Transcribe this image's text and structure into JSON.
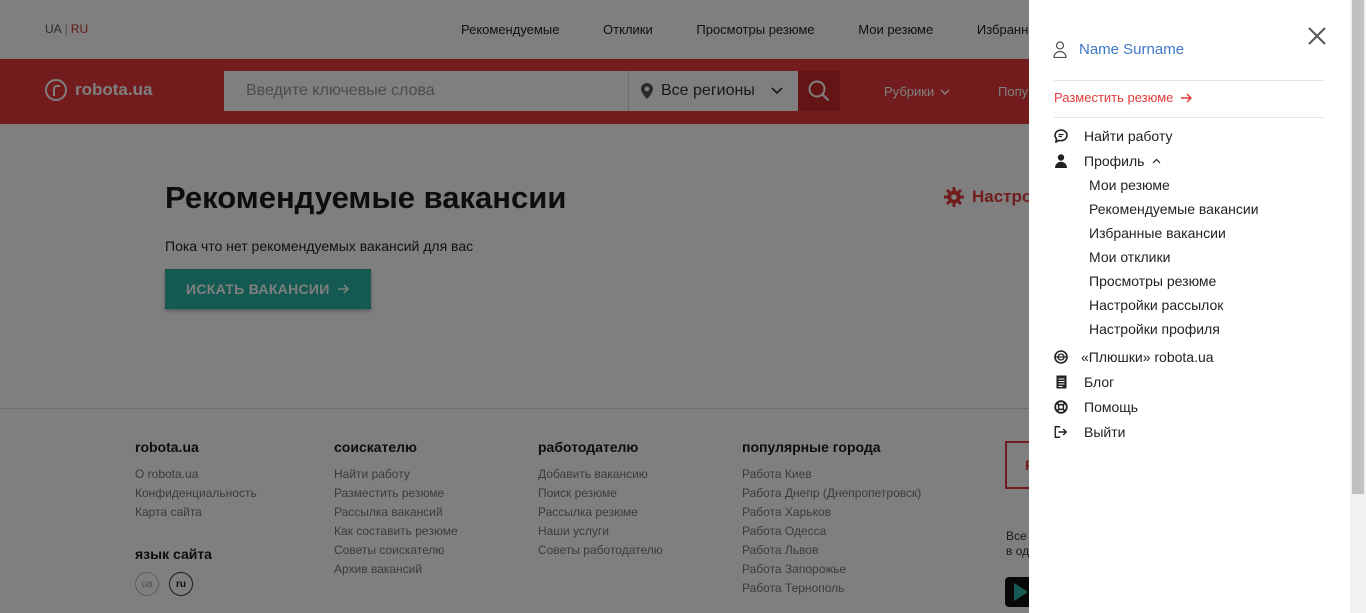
{
  "page": {
    "lang": {
      "ua": "UA",
      "sep": "|",
      "ru": "RU"
    },
    "topnav": [
      "Рекомендуемые",
      "Отклики",
      "Просмотры резюме",
      "Мои резюме",
      "Избранные"
    ],
    "logo": "robota.ua",
    "search_placeholder": "Введите ключевые слова",
    "region": "Все регионы",
    "rubriki": "Рубрики",
    "popular": "Попу",
    "title": "Рекомендуемые вакансии",
    "subtitle": "Пока что нет рекомендуемых вакансий для вас",
    "search_jobs_button": "ИСКАТЬ ВАКАНСИИ",
    "settings_link": "Настро"
  },
  "footer": {
    "col1": {
      "title": "robota.ua",
      "links": [
        "О robota.ua",
        "Конфиденциальность",
        "Карта сайта"
      ],
      "lang_title": "язык сайта",
      "langs": [
        "ua",
        "ru"
      ]
    },
    "col2": {
      "title": "соискателю",
      "links": [
        "Найти работу",
        "Разместить резюме",
        "Рассылка вакансий",
        "Как составить резюме",
        "Советы соискателю",
        "Архив вакансий"
      ]
    },
    "col3": {
      "title": "работодателю",
      "links": [
        "Добавить вакансию",
        "Поиск резюме",
        "Рассылка резюме",
        "Наши услуги",
        "Советы работодателю"
      ]
    },
    "col4": {
      "title": "популярные города",
      "links": [
        "Работа Киев",
        "Работа Днепр (Днепропетровск)",
        "Работа Харьков",
        "Работа Одесса",
        "Работа Львов",
        "Работа Запорожье",
        "Работа Тернополь"
      ]
    },
    "box_letter": "Р",
    "app_text_1": "Все",
    "app_text_2": "в од"
  },
  "drawer": {
    "user_name": "Name Surname",
    "post_resume": "Разместить резюме",
    "items": [
      {
        "label": "Найти работу",
        "icon": "chat-icon"
      },
      {
        "label": "Профиль",
        "icon": "person-icon"
      }
    ],
    "profile_sub": [
      "Мои резюме",
      "Рекомендуемые вакансии",
      "Избранные вакансии",
      "Мои отклики",
      "Просмотры резюме",
      "Настройки рассылок",
      "Настройки профиля"
    ],
    "bottom_items": [
      {
        "label": "«Плюшки» robota.ua",
        "icon": "gift-icon"
      },
      {
        "label": "Блог",
        "icon": "document-icon"
      },
      {
        "label": "Помощь",
        "icon": "lifebuoy-icon"
      },
      {
        "label": "Выйти",
        "icon": "logout-icon"
      }
    ]
  },
  "colors": {
    "brand_red": "#e4393b",
    "teal": "#2bb5a4",
    "link_blue": "#3e77c8"
  }
}
